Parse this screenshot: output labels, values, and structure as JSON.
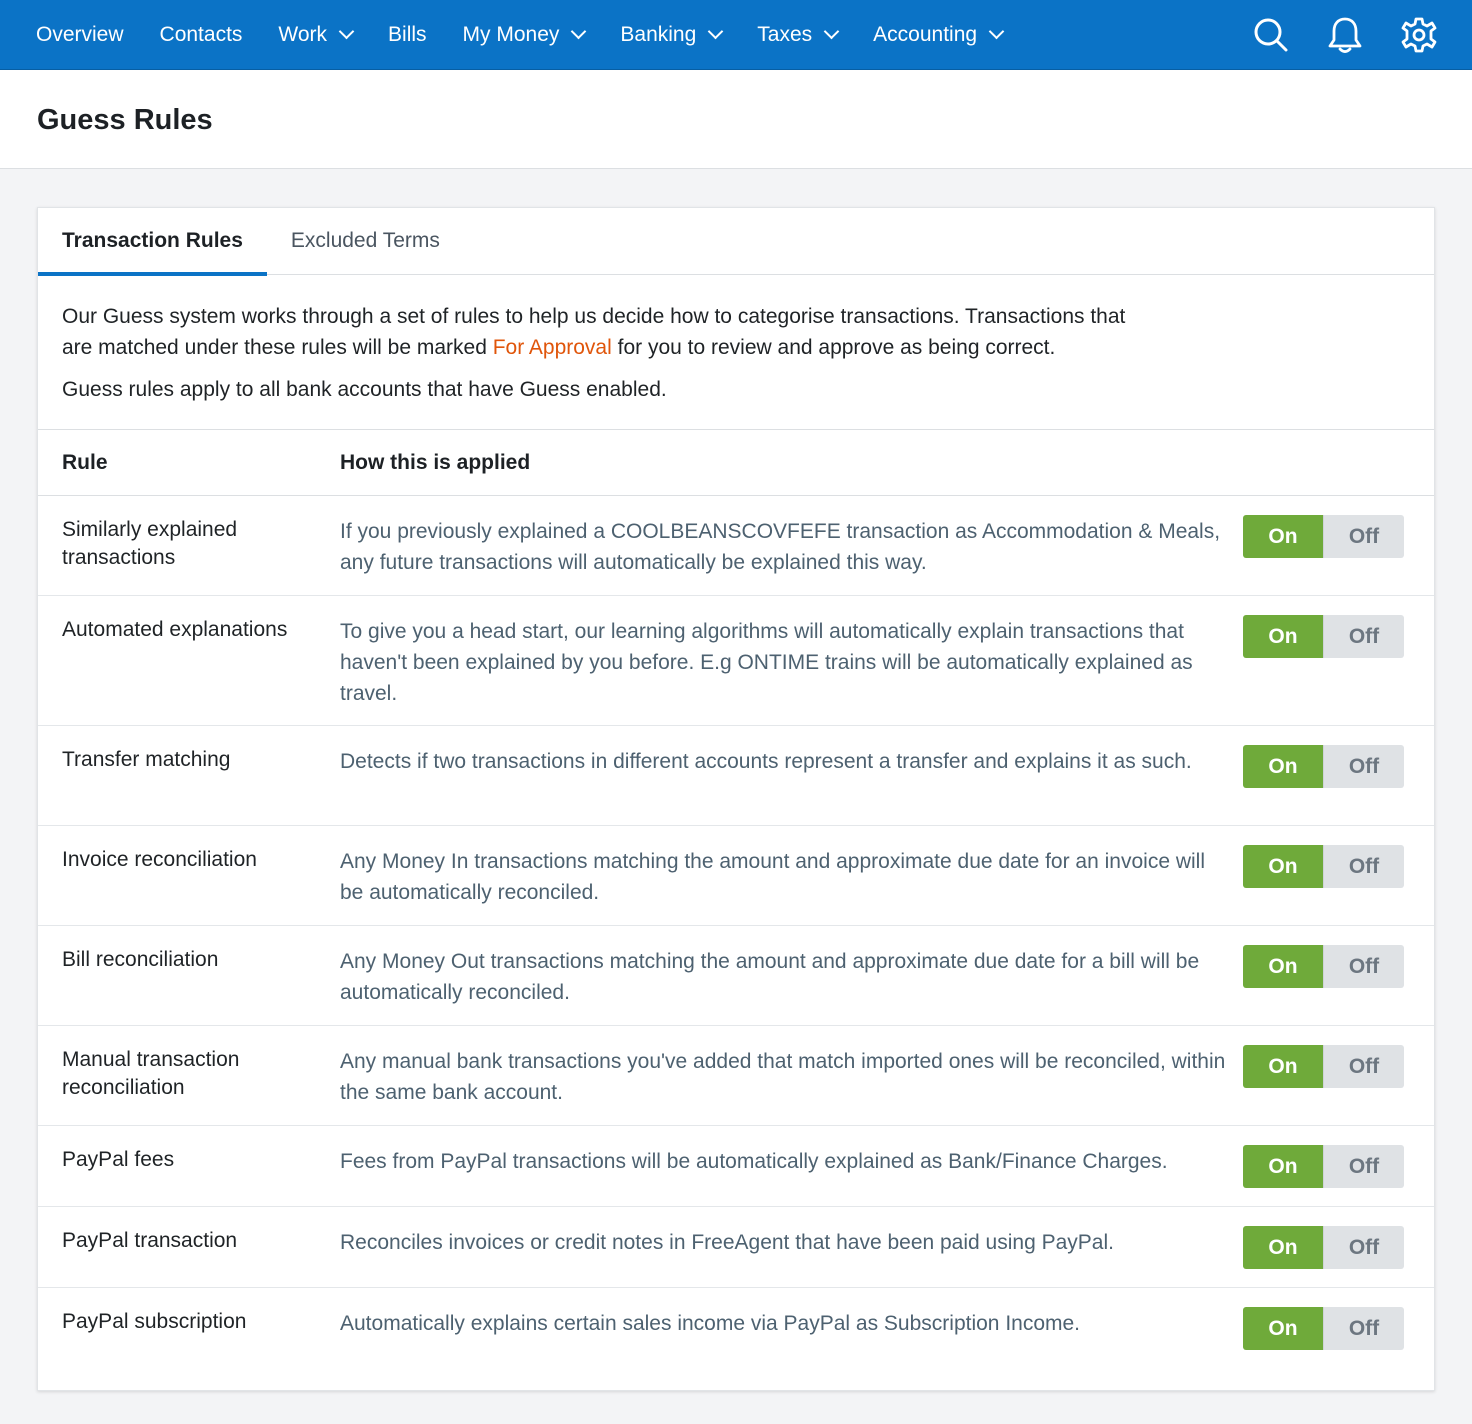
{
  "nav": {
    "items": [
      {
        "label": "Overview",
        "dropdown": false
      },
      {
        "label": "Contacts",
        "dropdown": false
      },
      {
        "label": "Work",
        "dropdown": true
      },
      {
        "label": "Bills",
        "dropdown": false
      },
      {
        "label": "My Money",
        "dropdown": true
      },
      {
        "label": "Banking",
        "dropdown": true
      },
      {
        "label": "Taxes",
        "dropdown": true
      },
      {
        "label": "Accounting",
        "dropdown": true
      }
    ],
    "icons": [
      "search-icon",
      "bell-icon",
      "gear-icon"
    ],
    "bg_color": "#0b73c6"
  },
  "page": {
    "title": "Guess Rules"
  },
  "tabs": [
    {
      "label": "Transaction Rules",
      "active": true
    },
    {
      "label": "Excluded Terms",
      "active": false
    }
  ],
  "intro": {
    "line1_before": "Our Guess system works through a set of rules to help us decide how to categorise transactions. Transactions that are matched under these rules will be marked ",
    "line1_highlight": "For Approval",
    "line1_after": " for you to review and approve as being correct.",
    "line2": "Guess rules apply to all bank accounts that have Guess enabled.",
    "highlight_color": "#e0550a"
  },
  "table": {
    "headers": {
      "rule": "Rule",
      "applied": "How this is applied"
    },
    "toggle_labels": {
      "on": "On",
      "off": "Off"
    },
    "rows": [
      {
        "name": "Similarly explained transactions",
        "desc": "If you previously explained a COOLBEANSCOVFEFE transaction as Accommodation & Meals, any future transactions will automatically be explained this way.",
        "state": "on"
      },
      {
        "name": "Automated explanations",
        "desc": "To give you a head start, our learning algorithms will automatically explain transactions that haven't been explained by you before. E.g ONTIME trains will be automatically explained as travel.",
        "state": "on"
      },
      {
        "name": "Transfer matching",
        "desc": "Detects if two transactions in different accounts represent a transfer and explains it as such.",
        "state": "on"
      },
      {
        "name": "Invoice reconciliation",
        "desc": "Any Money In transactions matching the amount and approximate due date for an invoice will be automatically reconciled.",
        "state": "on"
      },
      {
        "name": "Bill reconciliation",
        "desc": "Any Money Out transactions matching the amount and approximate due date for a bill will be automatically reconciled.",
        "state": "on"
      },
      {
        "name": "Manual transaction reconciliation",
        "desc": "Any manual bank transactions you've added that match imported ones will be reconciled, within the same bank account.",
        "state": "on"
      },
      {
        "name": "PayPal fees",
        "desc": "Fees from PayPal transactions will be automatically explained as Bank/Finance Charges.",
        "state": "on"
      },
      {
        "name": "PayPal transaction",
        "desc": "Reconciles invoices or credit notes in FreeAgent that have been paid using PayPal.",
        "state": "on"
      },
      {
        "name": "PayPal subscription",
        "desc": "Automatically explains certain sales income via PayPal as Subscription Income.",
        "state": "on"
      }
    ],
    "on_color": "#6faa3a",
    "off_color": "#dfe2e5"
  }
}
